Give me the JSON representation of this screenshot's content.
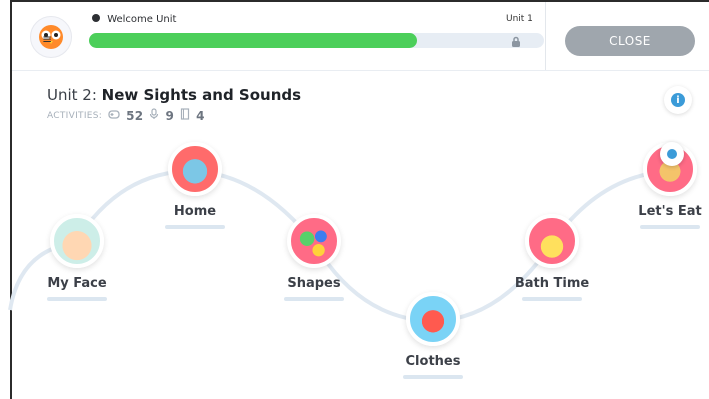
{
  "header": {
    "progress_title": "Welcome Unit",
    "unit_short": "Unit 1",
    "progress_fraction": 0.72,
    "close_label": "CLOSE",
    "avatar_icon": "owl-avatar-icon",
    "menu_icon": "≡"
  },
  "unit": {
    "title_prefix": "Unit 2: ",
    "title_bold": "New Sights and Sounds",
    "activities_label": "ACTIVITIES:",
    "counts": {
      "games": "52",
      "audio": "9",
      "books": "4"
    }
  },
  "nodes": {
    "my_face": "My Face",
    "home": "Home",
    "shapes": "Shapes",
    "clothes": "Clothes",
    "bath_time": "Bath Time",
    "lets_eat": "Let's Eat"
  },
  "colors": {
    "progress": "#4ccf5a",
    "close_button": "#9fa6ad",
    "accent_blue": "#3b9bd8"
  },
  "icons": {
    "info": "info-icon",
    "lock": "lock-icon",
    "location_pin": "location-pin-icon"
  }
}
